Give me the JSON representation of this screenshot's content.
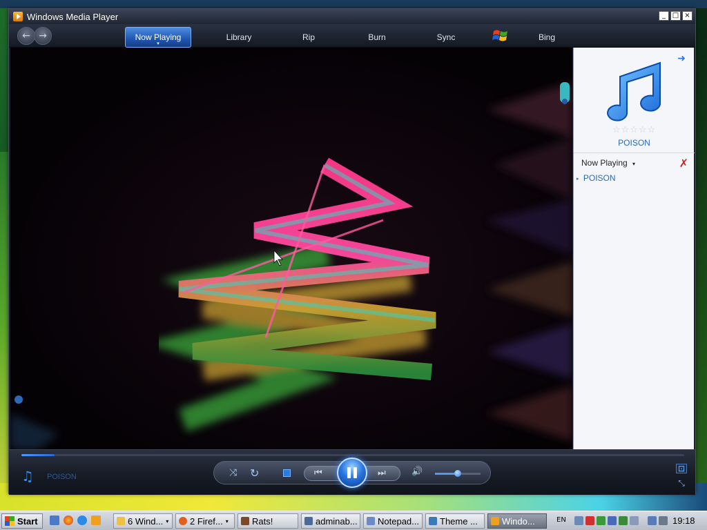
{
  "window": {
    "title": "Windows Media Player",
    "buttons": [
      "_",
      "□",
      "×"
    ]
  },
  "nav": {
    "back_icon": "←",
    "forward_icon": "→",
    "tabs": [
      {
        "label": "Now Playing",
        "active": true
      },
      {
        "label": "Library"
      },
      {
        "label": "Rip"
      },
      {
        "label": "Burn"
      },
      {
        "label": "Sync"
      },
      {
        "label": "Bing"
      }
    ]
  },
  "side_panel": {
    "go_icon": "➜",
    "rating_stars": "☆☆☆☆☆",
    "track_title": "POISON",
    "list_header": "Now Playing",
    "list_header_caret": "▾",
    "clear_icon": "✗",
    "playlist": [
      {
        "bullet": "▸",
        "title": "POISON"
      }
    ]
  },
  "controls": {
    "now_playing_note": "♫",
    "now_playing_title": "POISON",
    "seek_progress": 0.05,
    "volume_level": 0.5,
    "shuffle_icon": "⤨",
    "repeat_icon": "↻",
    "prev_icon": "⏮",
    "next_icon": "⏭",
    "volume_icon": "🔊",
    "switch_view_icon": "⊡",
    "mini_mode_icon": "⤡"
  },
  "taskbar": {
    "start_label": "Start",
    "tasks": [
      {
        "label": "6 Wind...",
        "dropdown": true,
        "icon_color": "#f0c040"
      },
      {
        "label": "2 Firef...",
        "dropdown": true,
        "icon_color": "#e06020"
      },
      {
        "label": "Rats!",
        "dropdown": false,
        "icon_color": "#7a4a2a"
      },
      {
        "label": "adminab...",
        "dropdown": false,
        "icon_color": "#4a6a9a"
      },
      {
        "label": "Notepad...",
        "dropdown": false,
        "icon_color": "#6a8ac8"
      },
      {
        "label": "Theme ...",
        "dropdown": false,
        "icon_color": "#3a7ab8"
      },
      {
        "label": "Windo...",
        "dropdown": false,
        "icon_color": "#f0a020",
        "active": true
      }
    ],
    "language": "EN",
    "clock": "19:18"
  },
  "colors": {
    "accent": "#2a78e0",
    "link": "#2a6ab8",
    "clear_red": "#d02020"
  }
}
